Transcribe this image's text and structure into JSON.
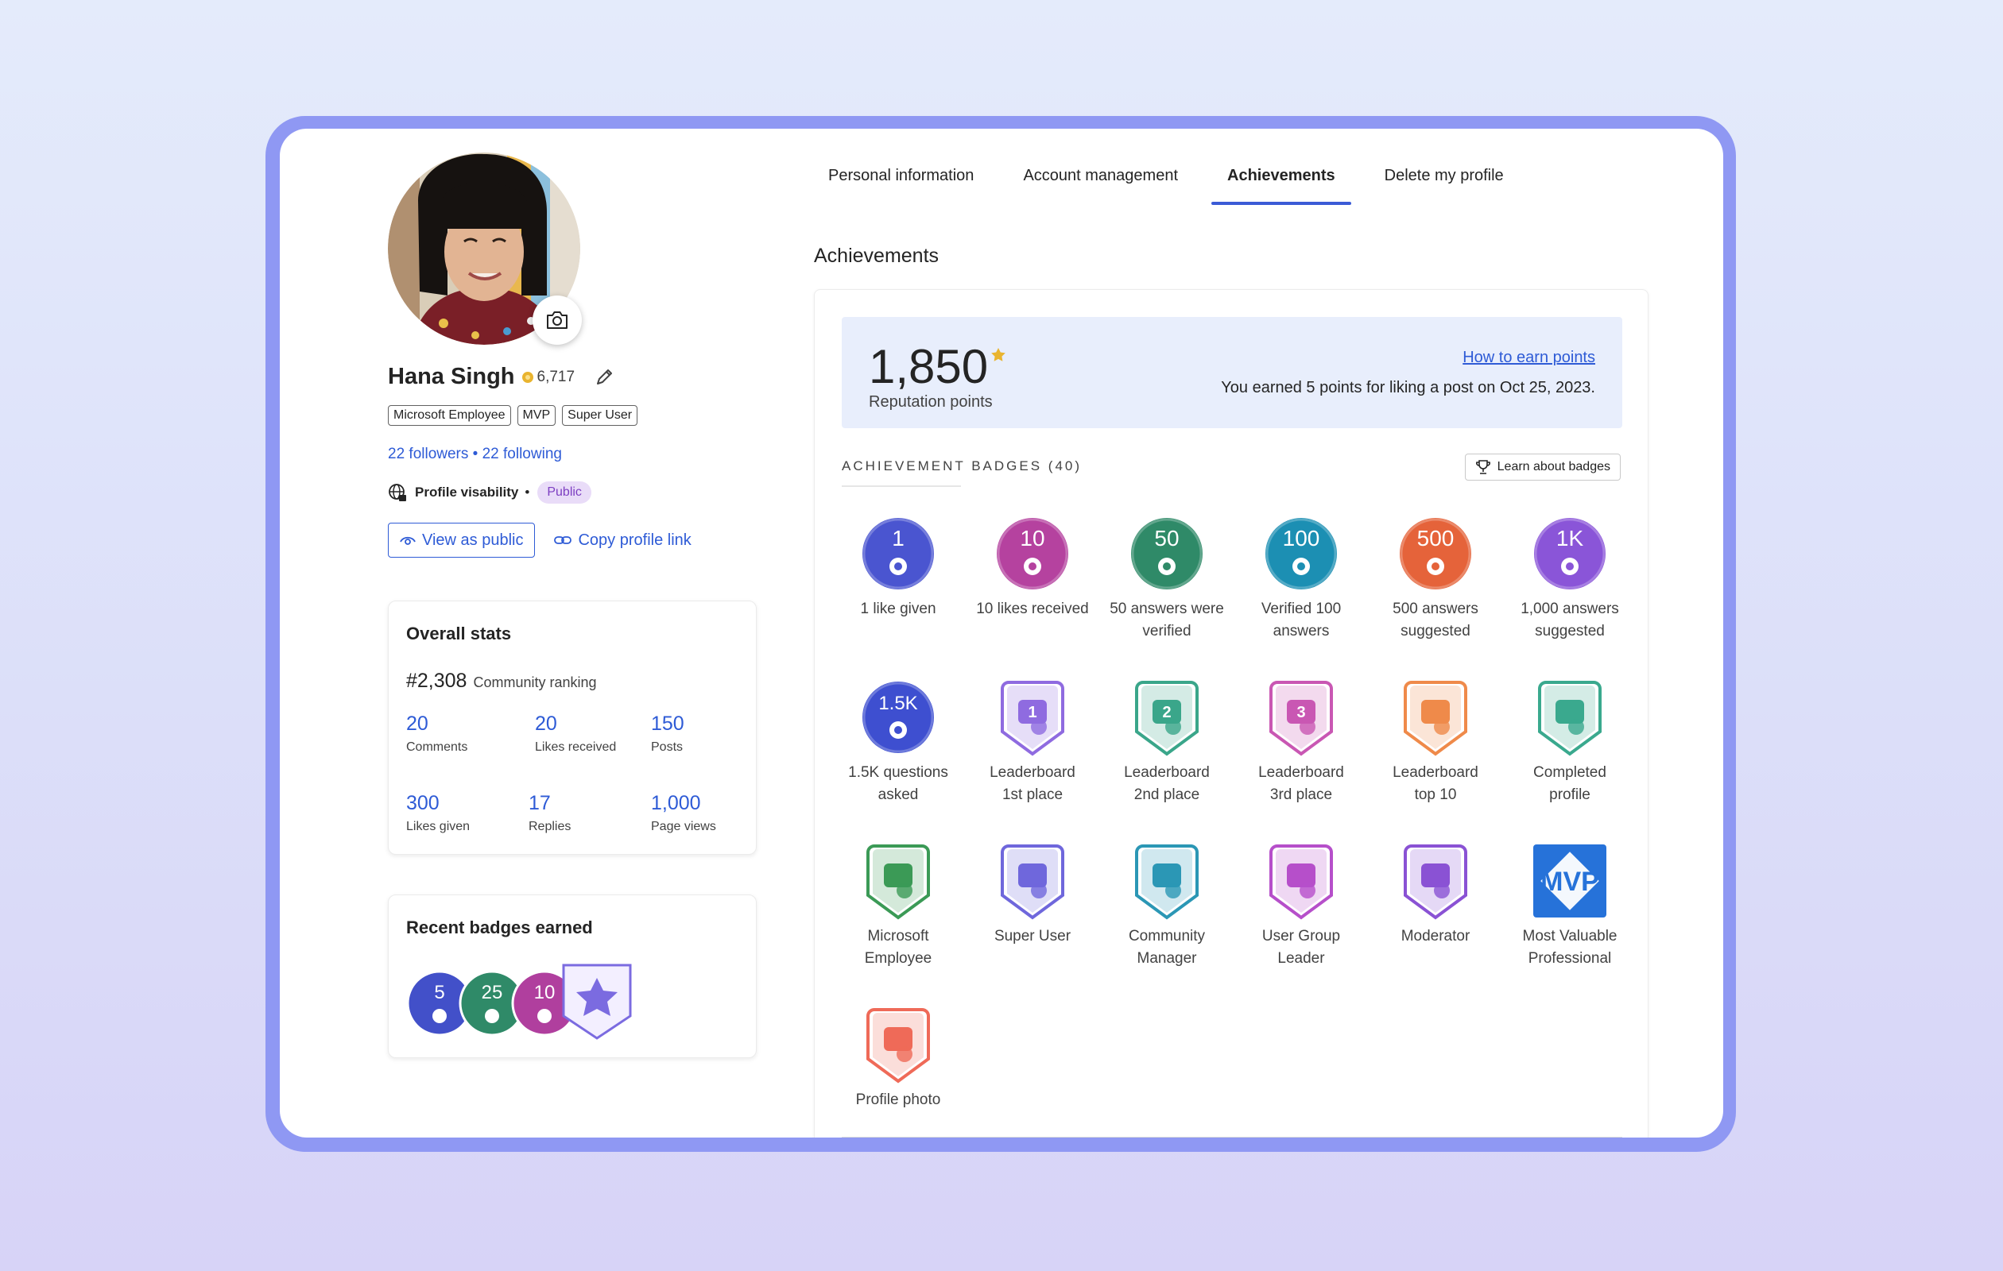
{
  "profile": {
    "name": "Hana Singh",
    "points": "6,717",
    "tags": [
      "Microsoft Employee",
      "MVP",
      "Super User"
    ],
    "followers": "22 followers",
    "separator": "•",
    "following": "22 following",
    "visibility_label": "Profile visability",
    "visibility_dot": "•",
    "visibility_value": "Public",
    "view_public_label": "View as public",
    "copy_link_label": "Copy profile link"
  },
  "stats": {
    "title": "Overall stats",
    "ranking_value": "#2,308",
    "ranking_label": "Community ranking",
    "items": [
      {
        "value": "20",
        "label": "Comments"
      },
      {
        "value": "20",
        "label": "Likes received"
      },
      {
        "value": "150",
        "label": "Posts"
      },
      {
        "value": "300",
        "label": "Likes given"
      },
      {
        "value": "17",
        "label": "Replies"
      },
      {
        "value": "1,000",
        "label": "Page views"
      }
    ]
  },
  "recent_badges": {
    "title": "Recent badges earned",
    "items": [
      {
        "number": "5",
        "icon": "thumbs-up-icon",
        "color": "#4250c9"
      },
      {
        "number": "25",
        "icon": "check-icon",
        "color": "#2f8a68"
      },
      {
        "number": "10",
        "icon": "like-received-icon",
        "color": "#b03f9e"
      },
      {
        "number": "",
        "icon": "super-user-icon",
        "color": "#7b6be0"
      }
    ]
  },
  "tabs": [
    {
      "label": "Personal information",
      "active": false
    },
    {
      "label": "Account management",
      "active": false
    },
    {
      "label": "Achievements",
      "active": true
    },
    {
      "label": "Delete my profile",
      "active": false
    }
  ],
  "achievements": {
    "title": "Achievements",
    "reputation_value": "1,850",
    "reputation_label": "Reputation points",
    "how_to_earn": "How to earn points",
    "earn_note": "You earned 5 points for liking a post on Oct 25, 2023.",
    "badges_header": "ACHIEVEMENT BADGES (40)",
    "learn_badges": "Learn about badges",
    "badges": [
      {
        "number": "1",
        "label_1": "1 like given",
        "label_2": "",
        "icon": "thumbs-up-icon",
        "color": "#4a55d0"
      },
      {
        "number": "10",
        "label_1": "10 likes received",
        "label_2": "",
        "icon": "like-received-icon",
        "color": "#b5429f"
      },
      {
        "number": "50",
        "label_1": "50 answers were",
        "label_2": "verified",
        "icon": "check-icon",
        "color": "#2f8a68"
      },
      {
        "number": "100",
        "label_1": "Verified 100",
        "label_2": "answers",
        "icon": "verified-chat-icon",
        "color": "#1c8fb3"
      },
      {
        "number": "500",
        "label_1": "500 answers",
        "label_2": "suggested",
        "icon": "lightbulb-icon",
        "color": "#e5633a"
      },
      {
        "number": "1K",
        "label_1": "1,000 answers",
        "label_2": "suggested",
        "icon": "person-answer-icon",
        "color": "#8a55d8"
      },
      {
        "number": "1.5K",
        "label_1": "1.5K questions",
        "label_2": "asked",
        "icon": "question-icon",
        "color": "#3e4fd0"
      },
      {
        "number": "1",
        "label_1": "Leaderboard",
        "label_2": "1st place",
        "icon": "trophy-icon",
        "color": "#8f6be0"
      },
      {
        "number": "2",
        "label_1": "Leaderboard",
        "label_2": "2nd place",
        "icon": "trophy-icon",
        "color": "#3aa68a"
      },
      {
        "number": "3",
        "label_1": "Leaderboard",
        "label_2": "3rd place",
        "icon": "trophy-icon",
        "color": "#c957b3"
      },
      {
        "number": "",
        "label_1": "Leaderboard",
        "label_2": "top 10",
        "icon": "leaderboard-list-icon",
        "color": "#ef8a4a"
      },
      {
        "number": "",
        "label_1": "Completed",
        "label_2": "profile",
        "icon": "profile-card-icon",
        "color": "#3aa98e"
      },
      {
        "number": "",
        "label_1": "Microsoft",
        "label_2": "Employee",
        "icon": "briefcase-icon",
        "color": "#3b9a56"
      },
      {
        "number": "",
        "label_1": "Super User",
        "label_2": "",
        "icon": "star-person-icon",
        "color": "#6f67dc"
      },
      {
        "number": "",
        "label_1": "Community",
        "label_2": "Manager",
        "icon": "globe-person-icon",
        "color": "#2b97b5"
      },
      {
        "number": "",
        "label_1": "User Group",
        "label_2": "Leader",
        "icon": "group-icon",
        "color": "#b64fca"
      },
      {
        "number": "",
        "label_1": "Moderator",
        "label_2": "",
        "icon": "gear-person-icon",
        "color": "#8a52d4"
      },
      {
        "number": "MVP",
        "label_1": "Most Valuable",
        "label_2": "Professional",
        "icon": "mvp-diamond-icon",
        "color": "#2672d9"
      },
      {
        "number": "",
        "label_1": "Profile photo",
        "label_2": "",
        "icon": "photo-sparkle-icon",
        "color": "#ef6a58"
      }
    ]
  }
}
